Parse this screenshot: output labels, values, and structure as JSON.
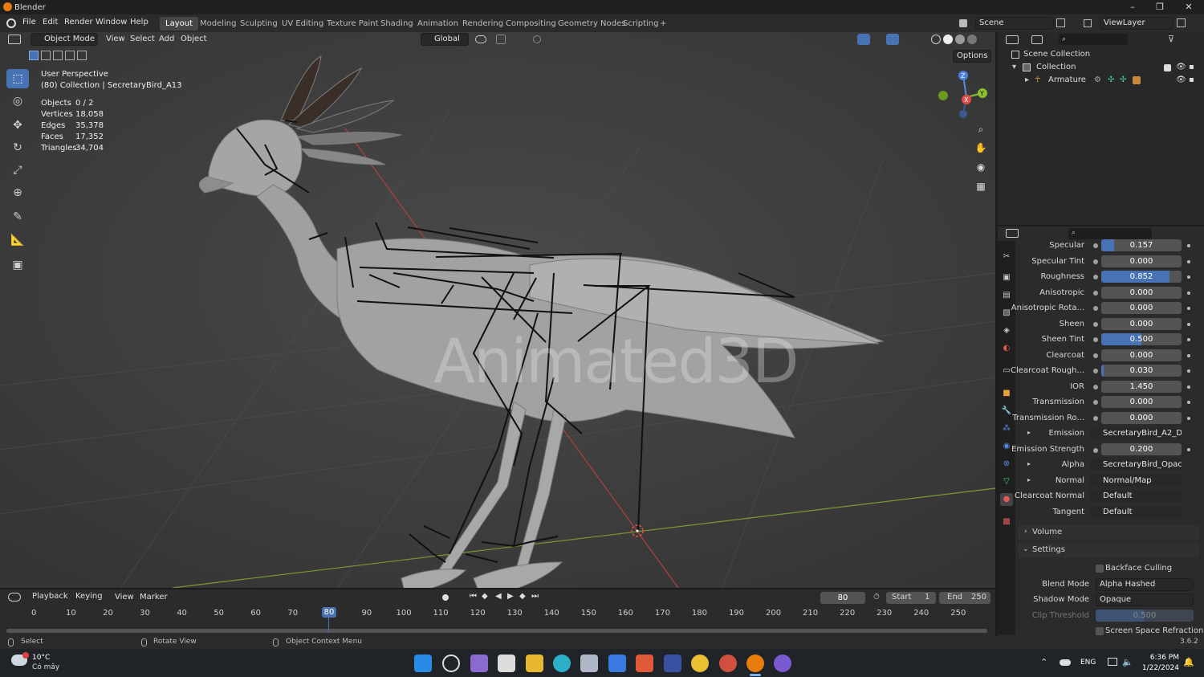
{
  "window": {
    "title": "Blender",
    "minimize": "–",
    "maximize": "❐",
    "close": "✕"
  },
  "menu": [
    "File",
    "Edit",
    "Render",
    "Window",
    "Help"
  ],
  "workspaces": [
    "Layout",
    "Modeling",
    "Sculpting",
    "UV Editing",
    "Texture Paint",
    "Shading",
    "Animation",
    "Rendering",
    "Compositing",
    "Geometry Nodes",
    "Scripting"
  ],
  "add_tab": "+",
  "scene": {
    "label": "Scene",
    "view_layer": "ViewLayer"
  },
  "viewport_header": {
    "mode": "Object Mode",
    "menus": [
      "View",
      "Select",
      "Add",
      "Object"
    ],
    "orientation": "Global",
    "options": "Options"
  },
  "overlay": {
    "perspective": "User Perspective",
    "collection": "(80) Collection | SecretaryBird_A13",
    "stats": [
      {
        "label": "Objects",
        "value": "0 / 2"
      },
      {
        "label": "Vertices",
        "value": "18,058"
      },
      {
        "label": "Edges",
        "value": "35,378"
      },
      {
        "label": "Faces",
        "value": "17,352"
      },
      {
        "label": "Triangles",
        "value": "34,704"
      }
    ]
  },
  "watermark": "Animated3D",
  "gizmo": {
    "z": "Z",
    "y": "Y",
    "x": "X"
  },
  "outliner": {
    "scene_collection": "Scene Collection",
    "collection": "Collection",
    "armature": "Armature"
  },
  "properties": {
    "rows": [
      {
        "label": "Specular",
        "value": "0.157",
        "fill": 0.157
      },
      {
        "label": "Specular Tint",
        "value": "0.000",
        "fill": 0
      },
      {
        "label": "Roughness",
        "value": "0.852",
        "fill": 0.852
      },
      {
        "label": "Anisotropic",
        "value": "0.000",
        "fill": 0
      },
      {
        "label": "Anisotropic Rota...",
        "value": "0.000",
        "fill": 0
      },
      {
        "label": "Sheen",
        "value": "0.000",
        "fill": 0
      },
      {
        "label": "Sheen Tint",
        "value": "0.500",
        "fill": 0.5
      },
      {
        "label": "Clearcoat",
        "value": "0.000",
        "fill": 0
      },
      {
        "label": "Clearcoat Rough...",
        "value": "0.030",
        "fill": 0.03
      },
      {
        "label": "IOR",
        "value": "1.450",
        "fill": 0
      },
      {
        "label": "Transmission",
        "value": "0.000",
        "fill": 0
      },
      {
        "label": "Transmission Ro...",
        "value": "0.000",
        "fill": 0
      }
    ],
    "emission": {
      "label": "Emission",
      "value": "SecretaryBird_A2_Diff..."
    },
    "emission_strength": {
      "label": "Emission Strength",
      "value": "0.200"
    },
    "alpha": {
      "label": "Alpha",
      "value": "SecretaryBird_Opacity..."
    },
    "normal": {
      "label": "Normal",
      "value": "Normal/Map"
    },
    "clearcoat_normal": {
      "label": "Clearcoat Normal",
      "value": "Default"
    },
    "tangent": {
      "label": "Tangent",
      "value": "Default"
    },
    "volume": "Volume",
    "settings": "Settings",
    "backface": "Backface Culling",
    "blend_mode": {
      "label": "Blend Mode",
      "value": "Alpha Hashed"
    },
    "shadow_mode": {
      "label": "Shadow Mode",
      "value": "Opaque"
    },
    "clip_threshold": {
      "label": "Clip Threshold",
      "value": "0.500"
    },
    "ssr": "Screen Space Refraction"
  },
  "timeline": {
    "menus": [
      "Playback",
      "Keying",
      "View",
      "Marker"
    ],
    "current": "80",
    "start_label": "Start",
    "start": "1",
    "end_label": "End",
    "end": "250",
    "ticks": [
      "0",
      "10",
      "20",
      "30",
      "40",
      "50",
      "60",
      "70",
      "80",
      "90",
      "100",
      "110",
      "120",
      "130",
      "140",
      "150",
      "160",
      "170",
      "180",
      "190",
      "200",
      "210",
      "220",
      "230",
      "240",
      "250"
    ],
    "playhead": "80"
  },
  "statusbar": {
    "select": "Select",
    "rotate": "Rotate View",
    "context": "Object Context Menu",
    "version": "3.6.2"
  },
  "taskbar": {
    "weather_temp": "10°C",
    "weather_desc": "Có mây",
    "lang": "ENG",
    "time": "6:36 PM",
    "date": "1/22/2024"
  }
}
